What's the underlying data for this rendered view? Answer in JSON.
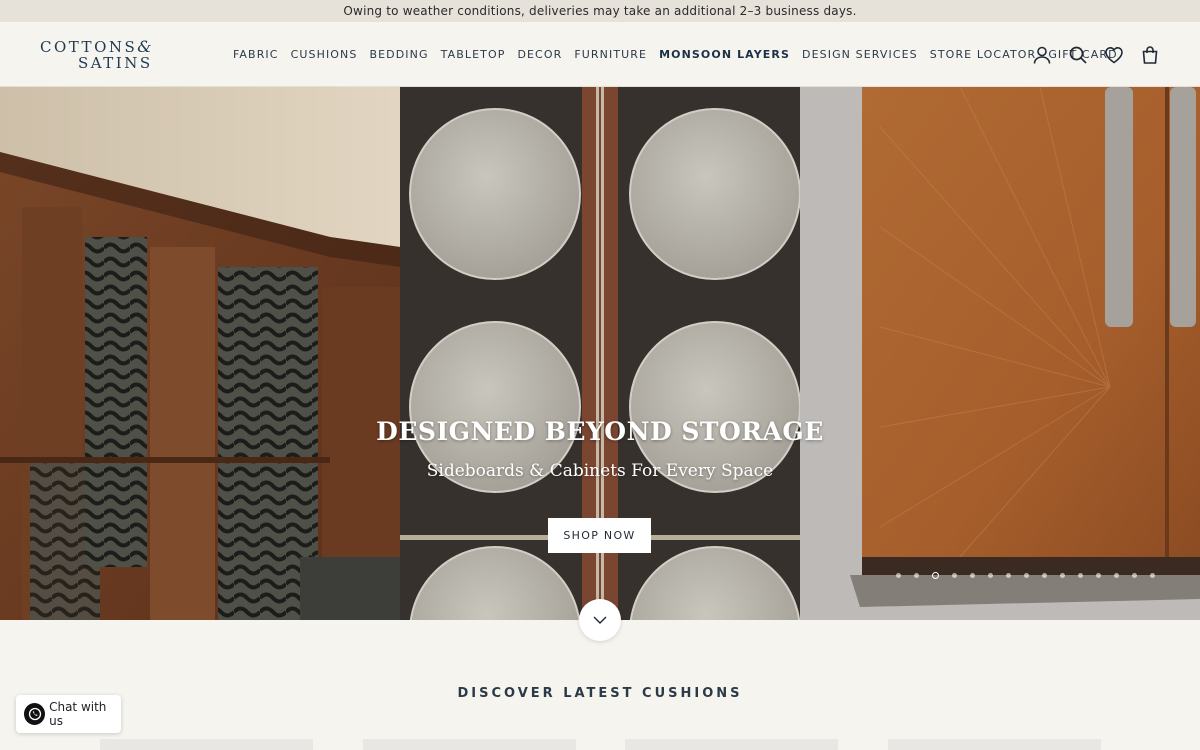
{
  "announcement": "Owing to weather conditions, deliveries may take an additional 2–3 business days.",
  "logo": {
    "line1": "COTTONS",
    "amp": "&",
    "line2": "SATINS"
  },
  "nav": [
    {
      "label": "FABRIC"
    },
    {
      "label": "CUSHIONS"
    },
    {
      "label": "BEDDING"
    },
    {
      "label": "TABLETOP"
    },
    {
      "label": "DECOR"
    },
    {
      "label": "FURNITURE"
    },
    {
      "label": "MONSOON LAYERS",
      "active": true
    },
    {
      "label": "DESIGN SERVICES"
    },
    {
      "label": "STORE LOCATOR"
    },
    {
      "label": "GIFT CARD"
    }
  ],
  "header_icons": [
    "account-icon",
    "search-icon",
    "wishlist-heart-icon",
    "cart-bag-icon"
  ],
  "hero": {
    "title": "DESIGNED BEYOND STORAGE",
    "subtitle": "Sideboards & Cabinets For Every Space",
    "cta": "SHOP NOW",
    "slide_count": 15,
    "active_slide": 3
  },
  "section": {
    "title": "DISCOVER LATEST CUSHIONS"
  },
  "chat": {
    "label": "Chat with us"
  },
  "colors": {
    "brand": "#1f3a52",
    "background": "#f6f4ef",
    "announce_bg": "#e6e2da"
  }
}
